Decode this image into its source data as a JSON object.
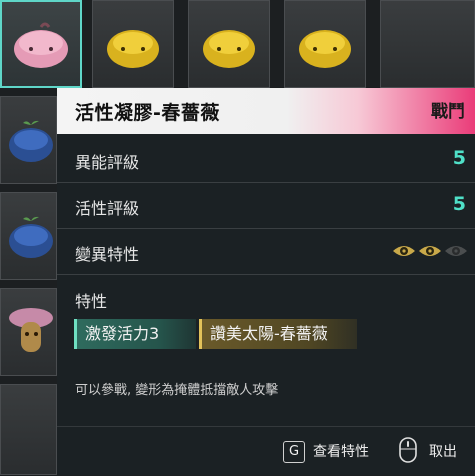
{
  "item": {
    "title": "活性凝膠-春薔薇",
    "type": "戰鬥"
  },
  "stats": [
    {
      "label": "異能評級",
      "value": "5"
    },
    {
      "label": "活性評級",
      "value": "5"
    }
  ],
  "mutation": {
    "label": "變異特性",
    "level_filled": 2,
    "level_max": 3
  },
  "traits": {
    "label": "特性",
    "items": [
      "激發活力3",
      "讚美太陽-春薔薇"
    ]
  },
  "description": "可以參戰, 變形為掩體抵擋敵人攻擊",
  "footer": {
    "key_label": "G",
    "inspect_label": "查看特性",
    "cancel_label": "取出"
  },
  "colors": {
    "accent": "#4fe0c8",
    "header_pink": "#ea3c79",
    "trait_green": "#2f6b5e",
    "trait_gold": "#6a5a2a"
  }
}
